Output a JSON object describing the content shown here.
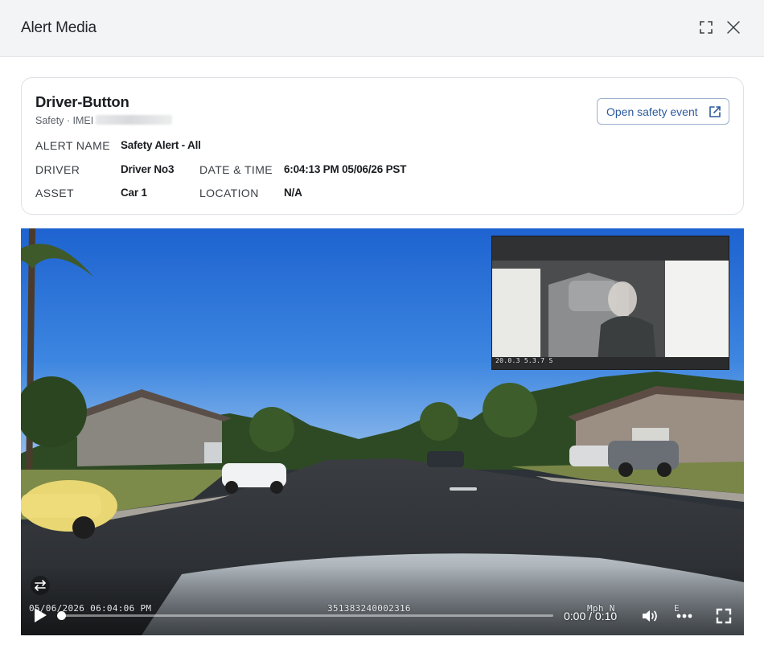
{
  "modal": {
    "title": "Alert Media",
    "expand_icon": "expand-icon",
    "close_icon": "close-icon"
  },
  "event": {
    "name": "Driver-Button",
    "subtitle_prefix": "Safety · IMEI",
    "open_button_label": "Open safety event",
    "open_button_icon": "external-link-icon",
    "fields": {
      "alert_name_label": "ALERT NAME",
      "alert_name": "Safety Alert - All",
      "driver_label": "DRIVER",
      "driver": "Driver No3",
      "date_time_label": "DATE & TIME",
      "date_time": "6:04:13 PM 05/06/26 PST",
      "asset_label": "ASSET",
      "asset": "Car 1",
      "location_label": "LOCATION",
      "location": "N/A"
    }
  },
  "player": {
    "overlay_timestamp": "05/06/2026 06:04:06 PM",
    "overlay_device_id": "351383240002316",
    "overlay_speed": "Mph N",
    "overlay_heading": "E",
    "pip_overlay": "20.0.3  5.3.7 S",
    "current_time": "0:00",
    "duration": "0:10",
    "time_display": "0:00 / 0:10",
    "progress": 0.0,
    "icons": {
      "swap": "swap-camera-icon",
      "play": "play-icon",
      "volume": "volume-icon",
      "more": "more-options-icon",
      "fullscreen": "fullscreen-icon"
    }
  }
}
